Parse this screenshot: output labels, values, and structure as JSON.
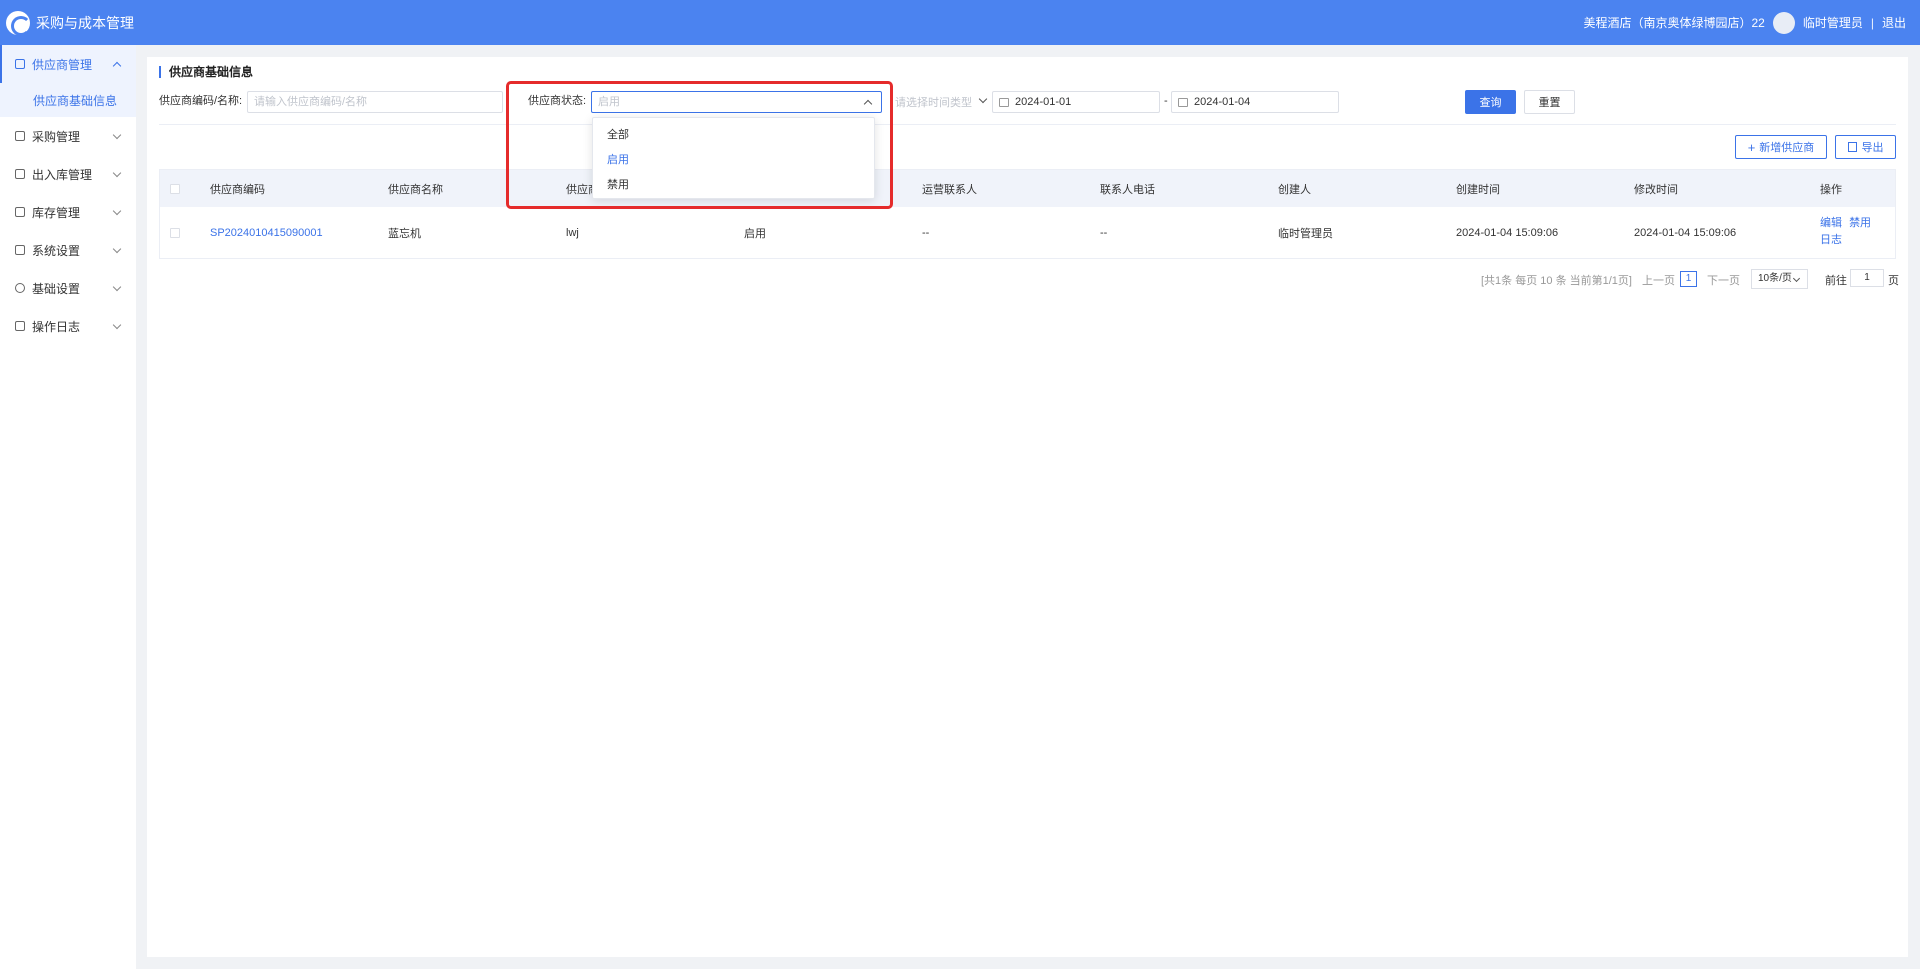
{
  "app": {
    "title": "采购与成本管理"
  },
  "header": {
    "store": "美程酒店（南京奥体绿博园店）22",
    "user": "临时管理员",
    "separator": "|",
    "logout": "退出"
  },
  "sidebar": {
    "items": [
      {
        "label": "供应商管理",
        "open": true,
        "children": [
          "供应商基础信息"
        ]
      },
      {
        "label": "采购管理"
      },
      {
        "label": "出入库管理"
      },
      {
        "label": "库存管理"
      },
      {
        "label": "系统设置"
      },
      {
        "label": "基础设置"
      },
      {
        "label": "操作日志"
      }
    ]
  },
  "page": {
    "title": "供应商基础信息"
  },
  "filters": {
    "code_label": "供应商编码/名称:",
    "code_placeholder": "请输入供应商编码/名称",
    "status_label": "供应商状态:",
    "status_placeholder": "启用",
    "time_type_placeholder": "请选择时间类型",
    "date_from": "2024-01-01",
    "date_sep": "-",
    "date_to": "2024-01-04",
    "query": "查询",
    "reset": "重置"
  },
  "actions": {
    "add": "新增供应商",
    "export": "导出"
  },
  "table": {
    "headers": [
      "供应商编码",
      "供应商名称",
      "供应商",
      "",
      "运营联系人",
      "联系人电话",
      "创建人",
      "创建时间",
      "修改时间",
      "操作"
    ],
    "rows": [
      {
        "code": "SP2024010415090001",
        "name": "蓝忘机",
        "short": "lwj",
        "status": "启用",
        "contact": "--",
        "phone": "--",
        "creator": "临时管理员",
        "created": "2024-01-04 15:09:06",
        "modified": "2024-01-04 15:09:06",
        "op_edit": "编辑",
        "op_disable": "禁用",
        "op_log": "日志"
      }
    ]
  },
  "pagination": {
    "summary": "[共1条 每页 10 条 当前第1/1页]",
    "prev": "上一页",
    "current": "1",
    "next": "下一页",
    "size": "10条/页",
    "goto": "前往",
    "goto_value": "1",
    "page_unit": "页"
  },
  "dropdown": {
    "options": [
      "全部",
      "启用",
      "禁用"
    ],
    "selected": "启用"
  },
  "colors": {
    "primary": "#4b83f0",
    "accent": "#3b73e8",
    "highlight": "#e52b2b"
  }
}
